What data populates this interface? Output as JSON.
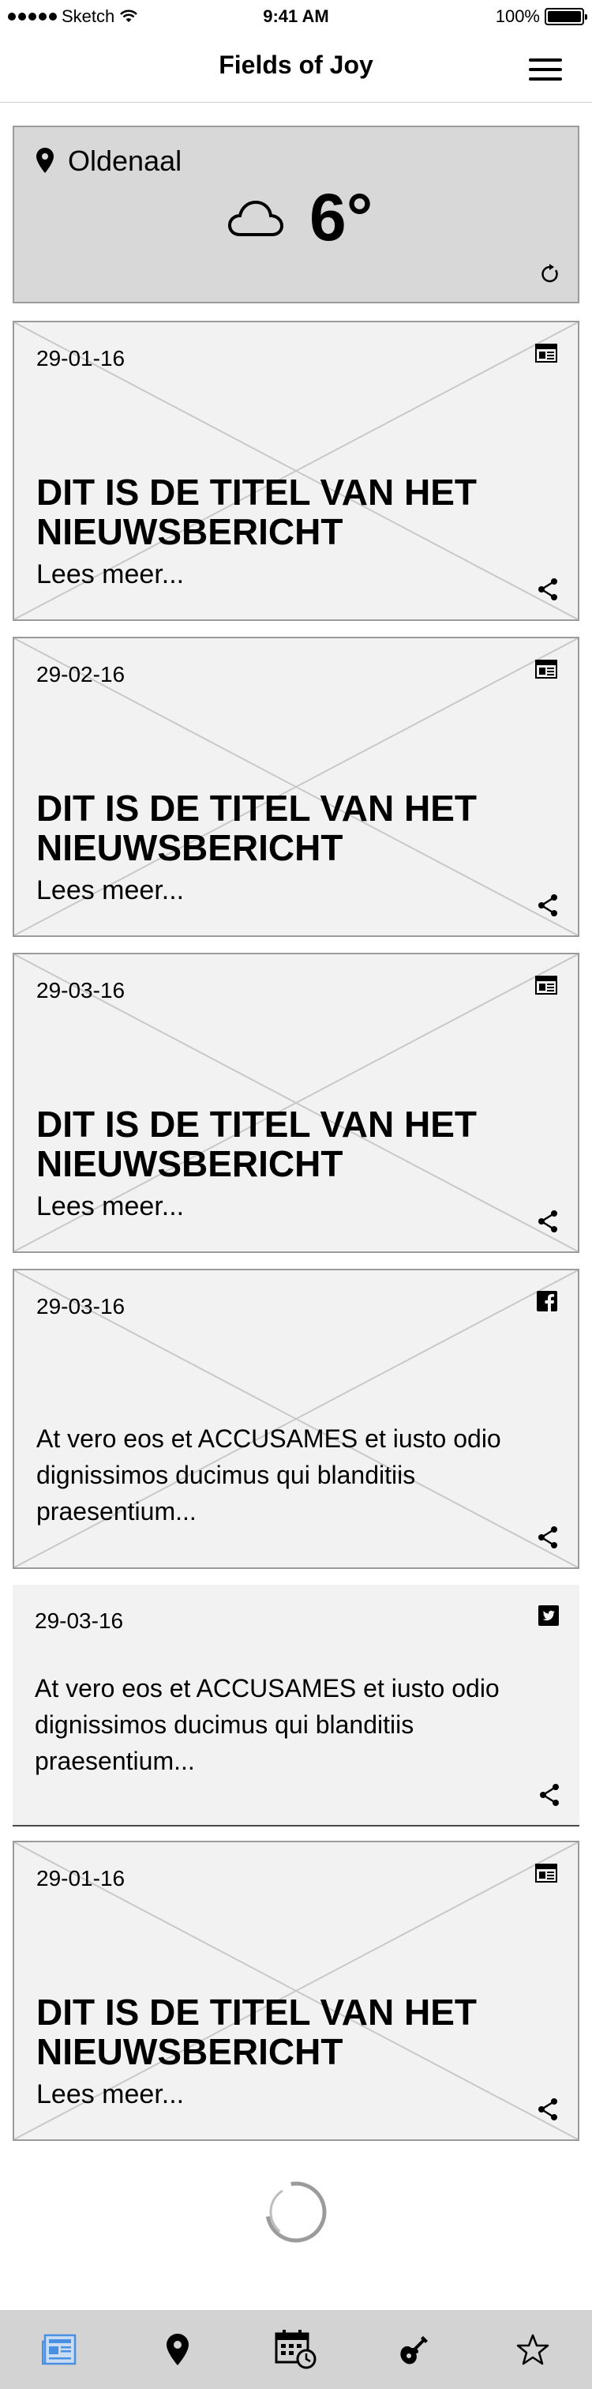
{
  "status_bar": {
    "carrier": "Sketch",
    "time": "9:41 AM",
    "battery_text": "100%",
    "battery_level": 1.0
  },
  "header": {
    "title": "Fields of Joy",
    "menu_icon": "hamburger-menu-icon"
  },
  "weather": {
    "location": "Oldenaal",
    "temperature": "6°",
    "condition_icon": "cloud-icon",
    "refresh_icon": "refresh-icon"
  },
  "feed": [
    {
      "date": "29-01-16",
      "source_icon": "newspaper-icon",
      "title": "DIT IS DE TITEL VAN HET NIEUWSBERICHT",
      "more": "Lees meer..."
    },
    {
      "date": "29-02-16",
      "source_icon": "newspaper-icon",
      "title": "DIT IS DE TITEL VAN HET NIEUWSBERICHT",
      "more": "Lees meer..."
    },
    {
      "date": "29-03-16",
      "source_icon": "newspaper-icon",
      "title": "DIT IS DE TITEL VAN HET NIEUWSBERICHT",
      "more": "Lees meer..."
    },
    {
      "date": "29-03-16",
      "source_icon": "facebook-icon",
      "body": "At vero eos et ACCUSAMES et iusto odio dignissimos ducimus qui blanditiis praesentium..."
    },
    {
      "date": "29-03-16",
      "source_icon": "twitter-icon",
      "body": "At vero eos et ACCUSAMES et iusto odio dignissimos ducimus qui blanditiis praesentium..."
    },
    {
      "date": "29-01-16",
      "source_icon": "newspaper-icon",
      "title": "DIT IS DE TITEL VAN HET NIEUWSBERICHT",
      "more": "Lees meer..."
    }
  ],
  "tab_bar": {
    "tabs": [
      "news-icon",
      "location-pin-icon",
      "calendar-clock-icon",
      "guitar-icon",
      "star-icon"
    ],
    "active": "news-icon",
    "active_color": "#4a90e2"
  }
}
